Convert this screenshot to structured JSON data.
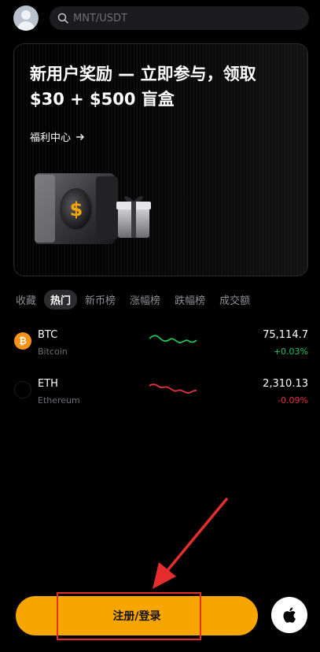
{
  "search": {
    "placeholder": "MNT/USDT"
  },
  "promo": {
    "title_line1": "新用户奖励 — 立即参与，领取",
    "title_line2": "$30 + $500 盲盒",
    "link_label": "福利中心",
    "coin_symbol": "$"
  },
  "tabs": [
    {
      "label": "收藏",
      "active": false
    },
    {
      "label": "热门",
      "active": true
    },
    {
      "label": "新币榜",
      "active": false
    },
    {
      "label": "涨幅榜",
      "active": false
    },
    {
      "label": "跌幅榜",
      "active": false
    },
    {
      "label": "成交额",
      "active": false
    }
  ],
  "markets": [
    {
      "symbol": "BTC",
      "name": "Bitcoin",
      "price": "75,114.7",
      "change": "+0.03%",
      "trend": "up",
      "icon_color": "#f7931a",
      "icon_glyph": "₿"
    },
    {
      "symbol": "ETH",
      "name": "Ethereum",
      "price": "2,310.13",
      "change": "-0.09%",
      "trend": "down",
      "icon_color": "#000000",
      "icon_glyph": ""
    }
  ],
  "colors": {
    "accent": "#f7a600",
    "up": "#21c35a",
    "down": "#e5343c",
    "annotation": "#e52d2d"
  },
  "cta": {
    "label": "注册/登录"
  },
  "icons": {
    "apple": "apple-icon",
    "search": "search-icon",
    "avatar": "avatar-icon"
  }
}
